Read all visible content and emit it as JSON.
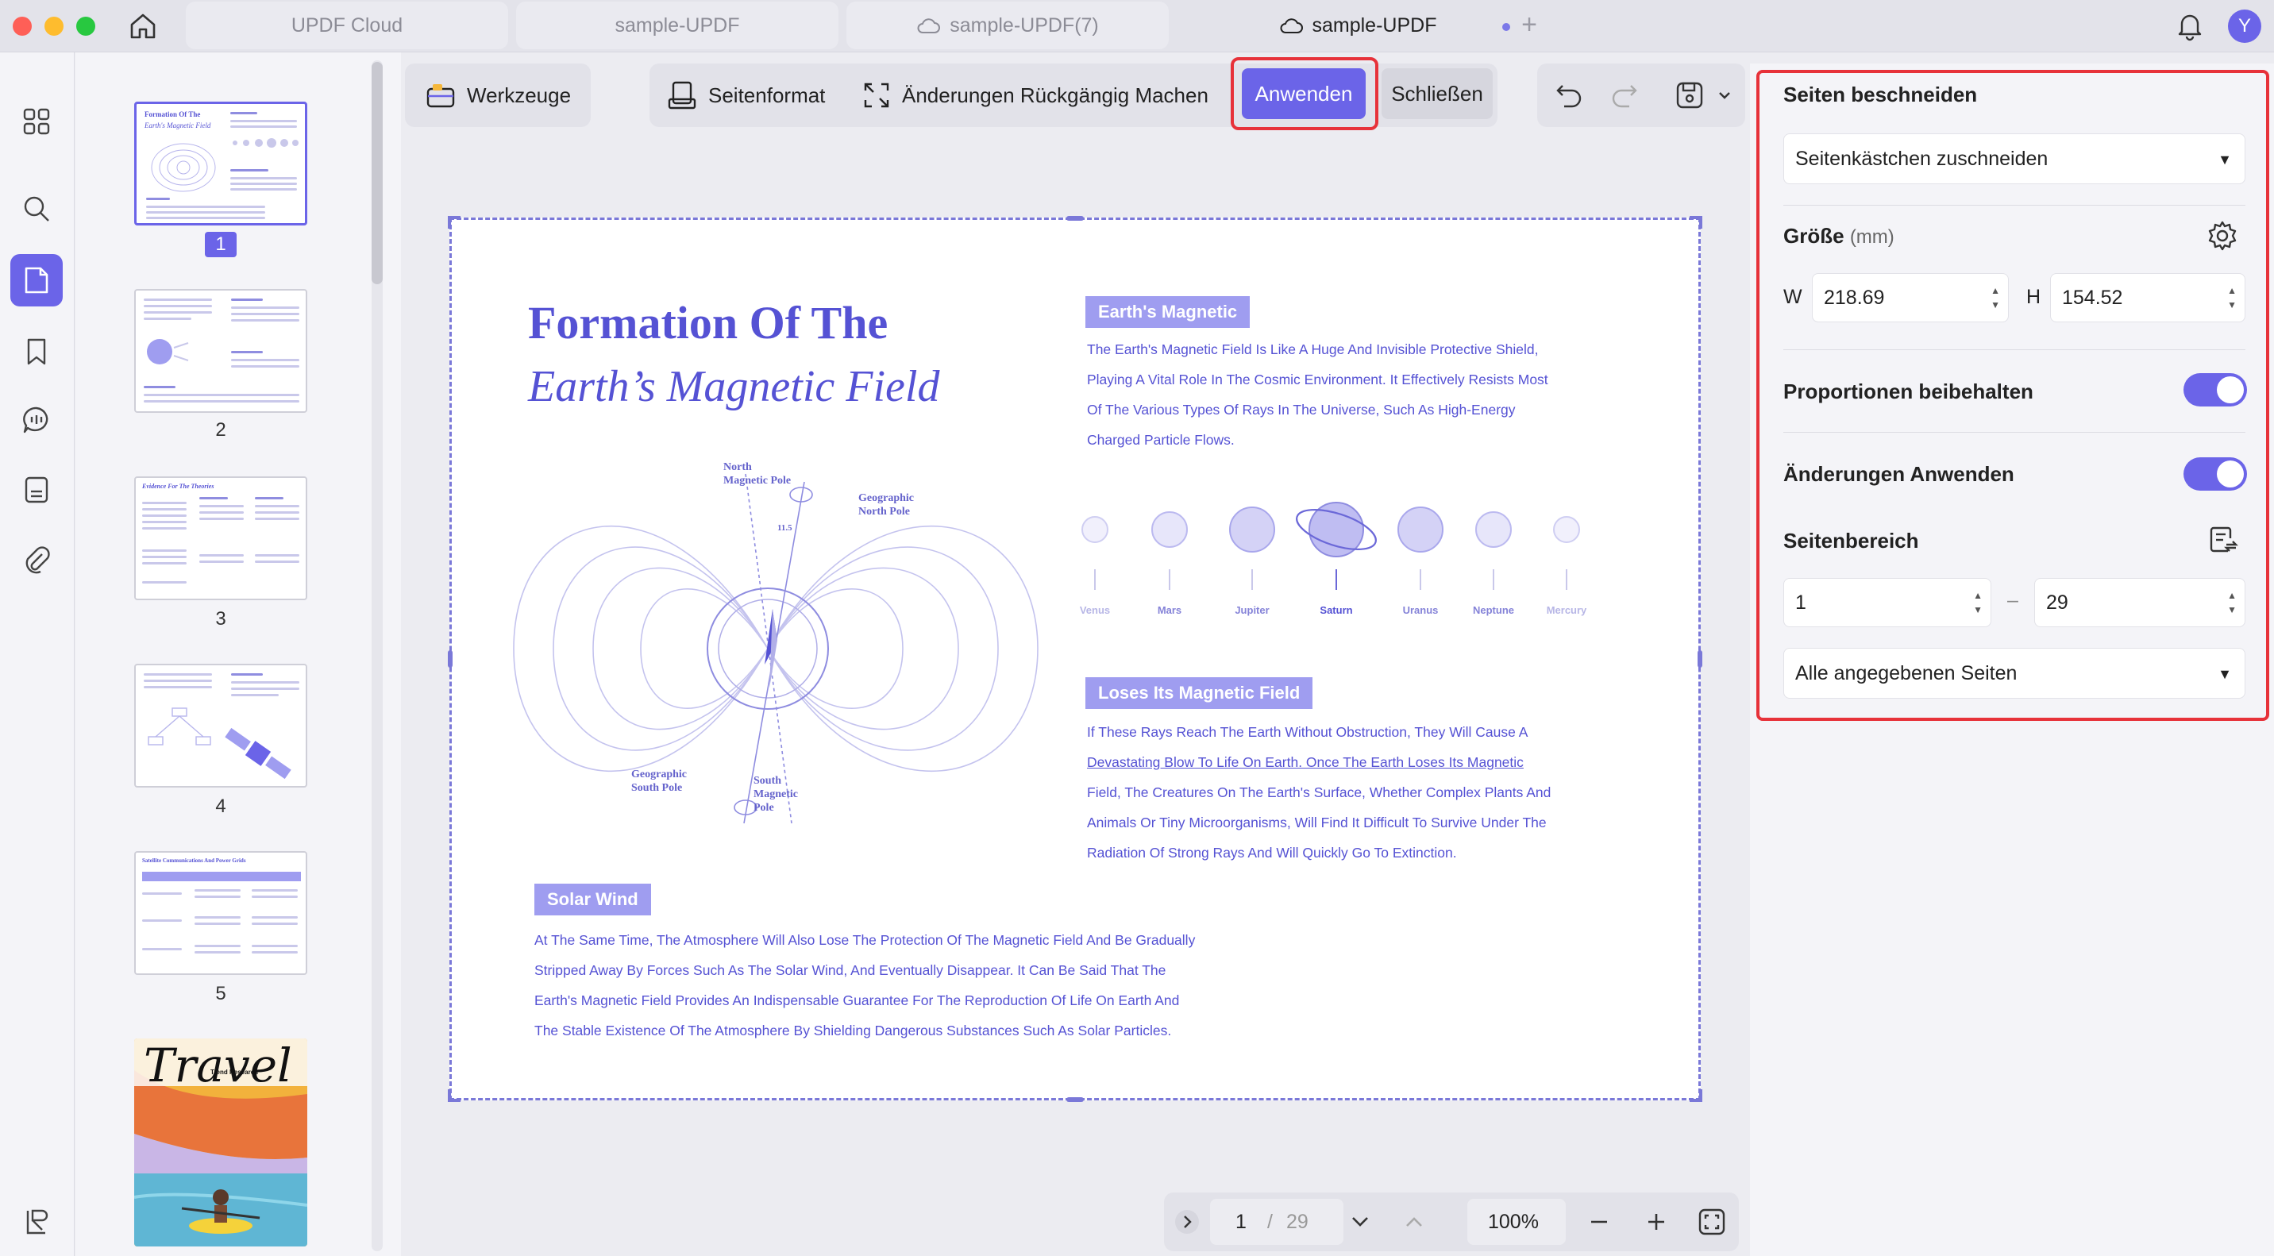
{
  "tabs": [
    {
      "label": "UPDF Cloud"
    },
    {
      "label": "sample-UPDF"
    },
    {
      "label": "sample-UPDF(7)"
    },
    {
      "label": "sample-UPDF"
    }
  ],
  "user": {
    "initial": "Y"
  },
  "thumbnails": [
    {
      "num": "1"
    },
    {
      "num": "2"
    },
    {
      "num": "3"
    },
    {
      "num": "4"
    },
    {
      "num": "5"
    }
  ],
  "toolbar": {
    "tools": "Werkzeuge",
    "page_format": "Seitenformat",
    "undo_changes": "Änderungen Rückgängig Machen",
    "apply": "Anwenden",
    "close": "Schließen"
  },
  "document": {
    "title_line1": "Formation Of The",
    "title_line2": "Earth’s Magnetic Field",
    "tag_magnetic": "Earth's Magnetic",
    "para_magnetic": [
      "The Earth's Magnetic Field Is Like A Huge And Invisible Protective Shield,",
      "Playing A Vital Role In The Cosmic Environment. It Effectively Resists Most",
      "Of The Various Types Of Rays In The Universe, Such As High-Energy",
      "Charged Particle Flows."
    ],
    "diagram": {
      "north_magnetic": "North\nMagnetic Pole",
      "geo_north": "Geographic\nNorth Pole",
      "geo_south": "Geographic\nSouth Pole",
      "south_magnetic": "South\nMagnetic\nPole",
      "angle": "11.5"
    },
    "planets": [
      "Venus",
      "Mars",
      "Jupiter",
      "Saturn",
      "Uranus",
      "Neptune",
      "Mercury"
    ],
    "tag_loses": "Loses Its Magnetic Field",
    "para_loses": [
      "If These Rays Reach The Earth Without Obstruction, They Will Cause A",
      "Devastating Blow To Life On Earth. Once The Earth Loses Its Magnetic",
      "Field, The Creatures On The Earth's Surface, Whether Complex Plants And",
      "Animals Or Tiny Microorganisms, Will Find It Difficult To Survive Under The",
      "Radiation Of Strong Rays And Will Quickly Go To Extinction."
    ],
    "tag_solar": "Solar Wind",
    "para_solar": [
      "At The Same Time, The Atmosphere Will Also Lose The Protection Of The Magnetic Field And Be Gradually",
      "Stripped Away By Forces Such As The Solar Wind, And Eventually Disappear. It Can Be Said That The",
      "Earth's Magnetic Field Provides An Indispensable Guarantee For The Reproduction Of Life On Earth And",
      "The Stable Existence Of The Atmosphere By Shielding Dangerous Substances Such As Solar Particles."
    ]
  },
  "thumb_text": {
    "t1_title": "Formation Of The",
    "t1_sub": "Earth's Magnetic Field",
    "t3_title": "Evidence For The Theories",
    "t5_title": "Satellite Communications And Power Grids",
    "t6_title": "Travel",
    "t6_sub": "Trend Research"
  },
  "bottombar": {
    "current_page": "1",
    "separator": "/",
    "total_pages": "29",
    "zoom": "100%"
  },
  "panel": {
    "crop_title": "Seiten beschneiden",
    "crop_mode": "Seitenkästchen zuschneiden",
    "size_label": "Größe",
    "size_unit": "(mm)",
    "w_label": "W",
    "w_value": "218.69",
    "h_label": "H",
    "h_value": "154.52",
    "keep_ratio": "Proportionen beibehalten",
    "apply_changes": "Änderungen Anwenden",
    "page_range": "Seitenbereich",
    "range_from": "1",
    "range_dash": "–",
    "range_to": "29",
    "pages_option": "Alle angegebenen Seiten"
  },
  "colors": {
    "accent": "#6b64e8",
    "highlight": "#e7323a",
    "doc_text": "#5552d4"
  }
}
